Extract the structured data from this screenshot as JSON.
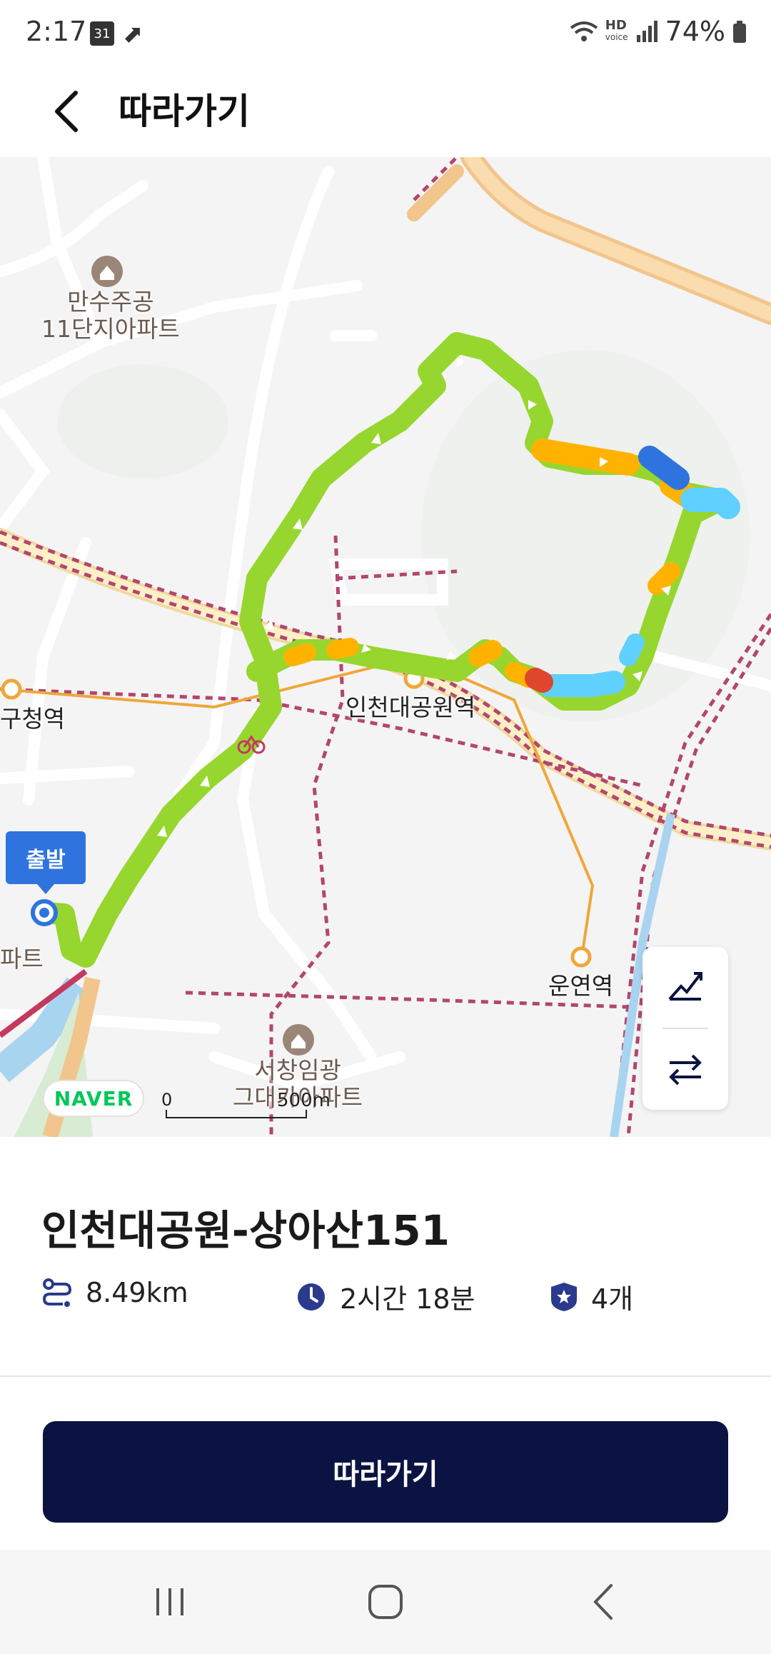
{
  "status_bar": {
    "time": "2:17",
    "calendar_day": "31",
    "network": "HD",
    "network_sub": "voice",
    "battery": "74%"
  },
  "header": {
    "title": "따라가기"
  },
  "map": {
    "places": [
      {
        "name": "만수주공\n11단지아파트"
      },
      {
        "name": "구청역"
      },
      {
        "name": "인천대공원역"
      },
      {
        "name": "파트"
      },
      {
        "name": "운연역"
      },
      {
        "name": "서창임광\n그대가아파트"
      }
    ],
    "start_label": "출발",
    "provider": "NAVER",
    "scale_zero": "0",
    "scale_distance": "500m"
  },
  "course": {
    "title": "인천대공원-상아산151",
    "distance": "8.49km",
    "duration": "2시간 18분",
    "stamps": "4개"
  },
  "actions": {
    "follow_label": "따라가기"
  },
  "colors": {
    "primary": "#0a1342",
    "route_green": "#97d62e",
    "route_orange": "#ffb300",
    "route_blue": "#2f74de"
  }
}
